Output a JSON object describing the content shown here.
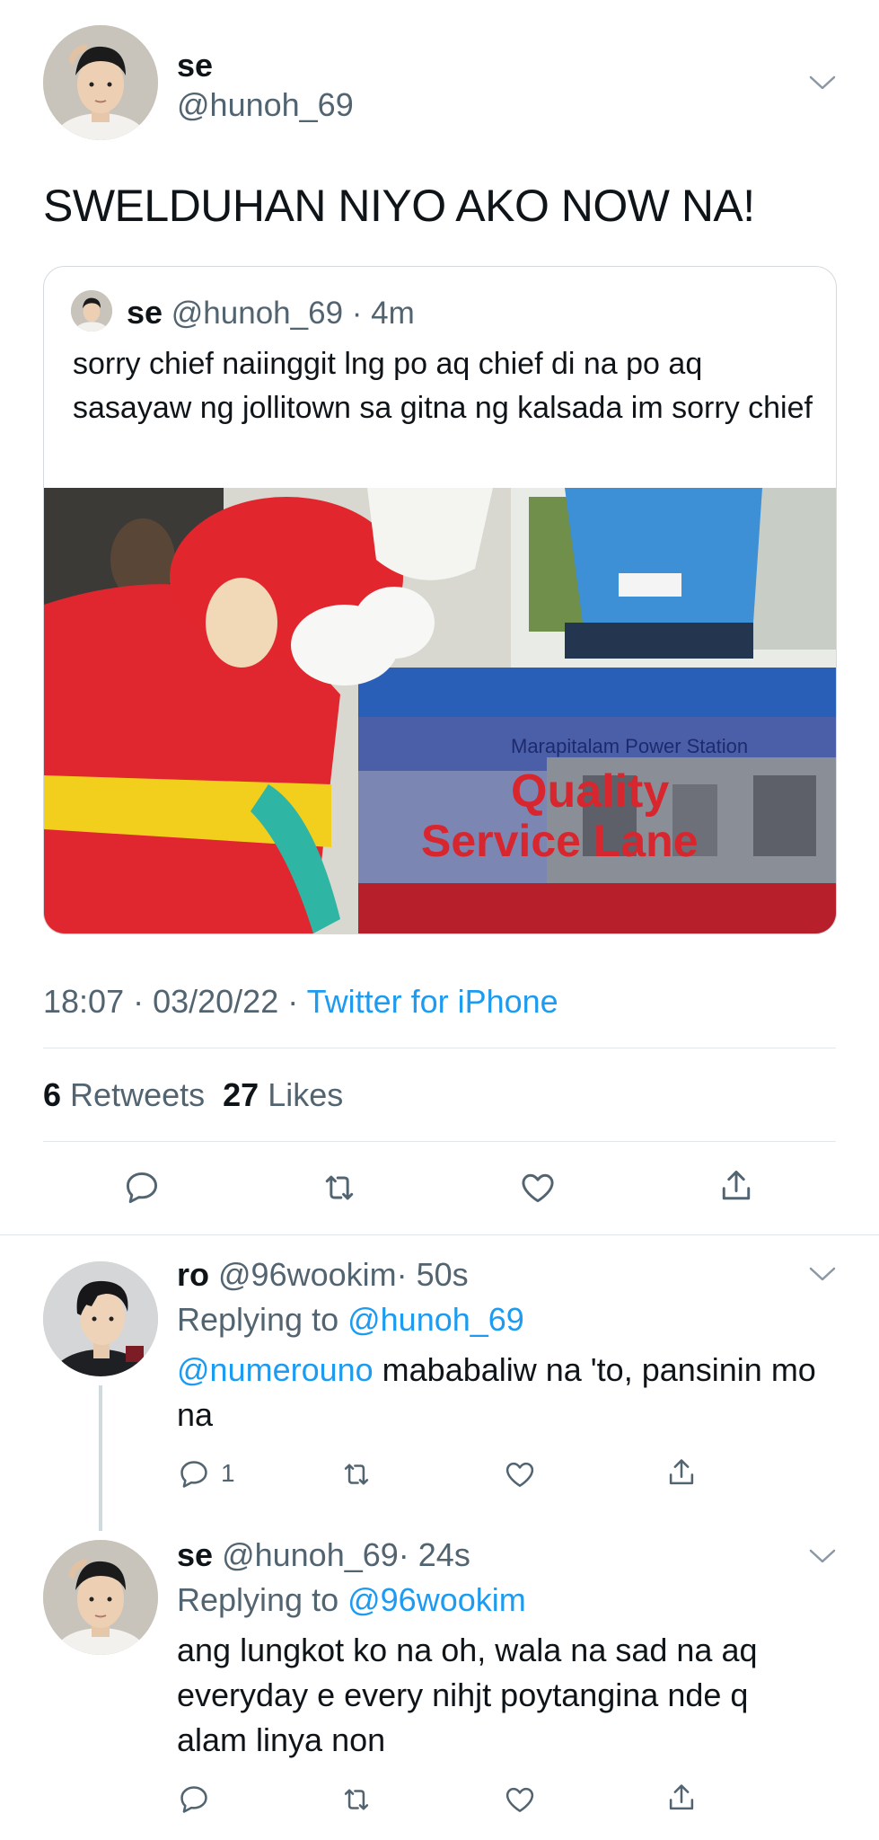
{
  "main_tweet": {
    "author_name": "se",
    "author_handle": "@hunoh_69",
    "text": "SWELDUHAN NIYO AKO NOW NA!",
    "timestamp": "18:07 · 03/20/22 · ",
    "client": "Twitter for iPhone",
    "retweets_count": "6",
    "retweets_label": "Retweets",
    "likes_count": "27",
    "likes_label": "Likes"
  },
  "quoted_tweet": {
    "author_name": "se",
    "author_handle": "@hunoh_69",
    "time": "· 4m",
    "text": "sorry chief naiinggit lng po aq chief di na po aq sasayaw ng jollitown sa gitna ng kalsada im sorry chief",
    "image_sign_line1": "Marapitalam Power Station",
    "image_sign_line2": "Quality",
    "image_sign_line3": "Service Lane"
  },
  "replies": [
    {
      "author_name": "ro",
      "author_handle": "@96wookim",
      "time": "· 50s",
      "replying_label": "Replying to ",
      "replying_to": "@hunoh_69",
      "mention": "@numerouno",
      "text": " mababaliw na 'to, pansinin mo na",
      "reply_count": "1"
    },
    {
      "author_name": "se",
      "author_handle": "@hunoh_69",
      "time": "· 24s",
      "replying_label": "Replying to ",
      "replying_to": "@96wookim",
      "text": "ang lungkot ko na oh, wala na sad na aq everyday e every nihjt poytangina nde q alam linya non"
    }
  ],
  "icons": [
    "chevron-down-icon",
    "reply-icon",
    "retweet-icon",
    "like-icon",
    "share-icon"
  ],
  "colors": {
    "accent": "#1d9bf0",
    "secondary_text": "#536471",
    "divider": "#e1e6ea"
  }
}
